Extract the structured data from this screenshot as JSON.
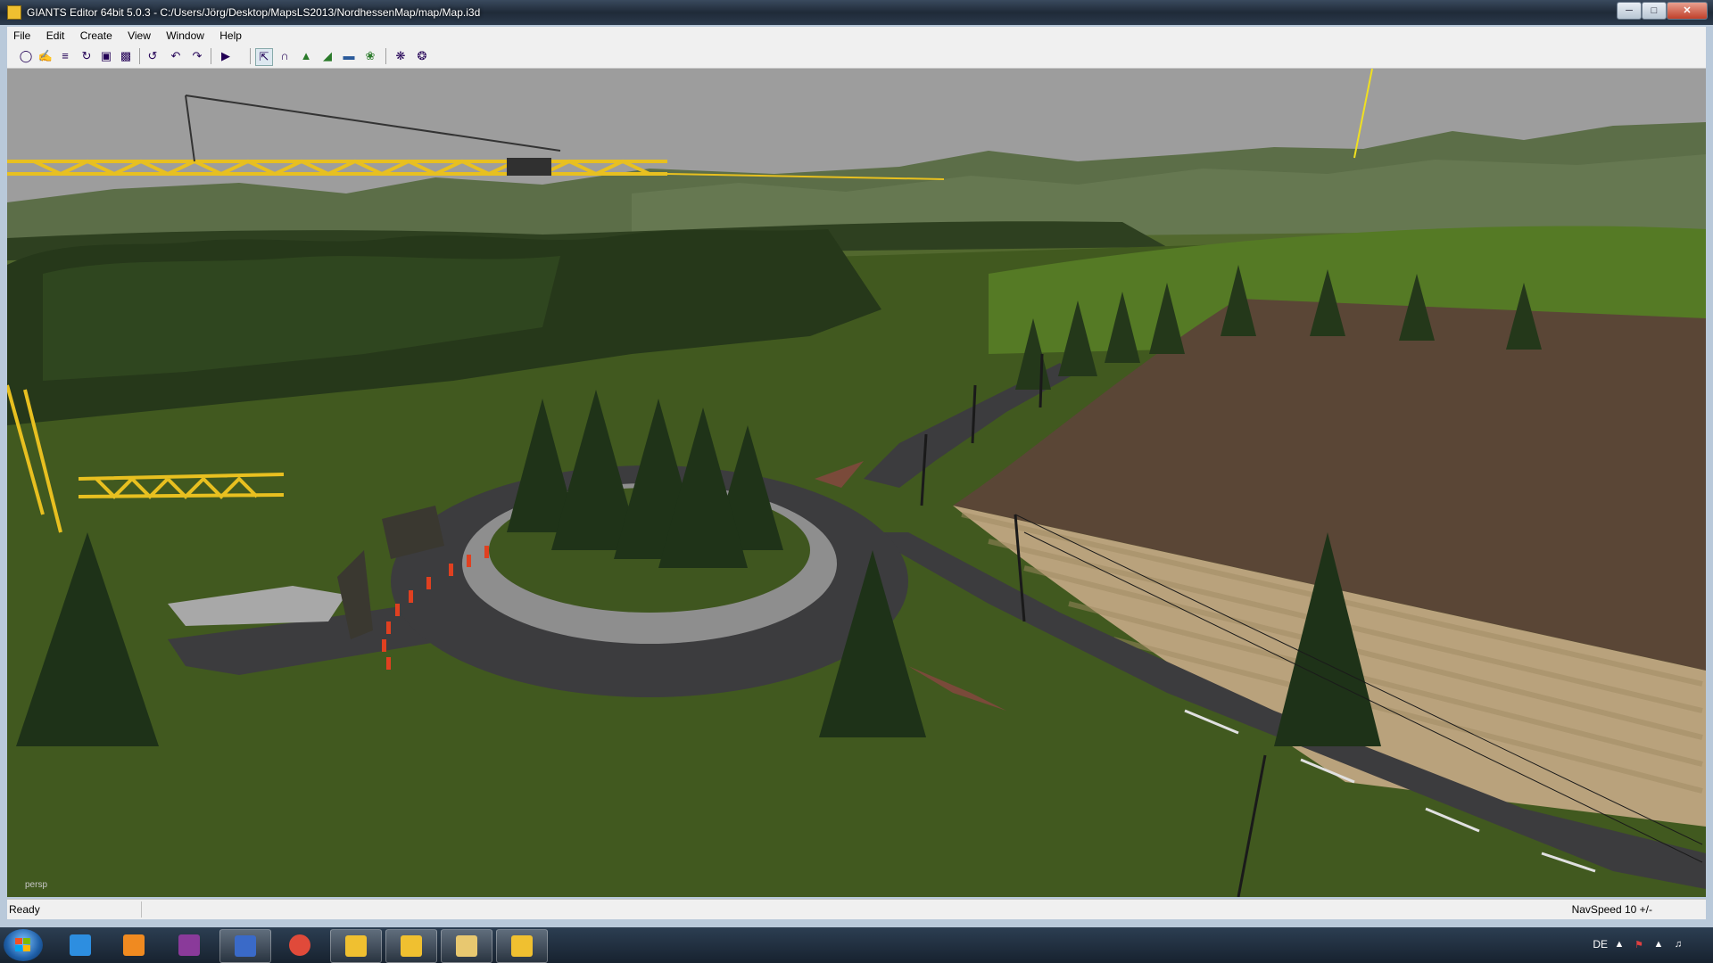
{
  "window": {
    "title": "GIANTS Editor 64bit 5.0.3 - C:/Users/Jörg/Desktop/MapsLS2013/NordhessenMap/map/Map.i3d",
    "minimize_icon": "minimize-icon",
    "maximize_icon": "maximize-icon",
    "close_icon": "close-icon"
  },
  "menu": {
    "items": [
      {
        "label": "File"
      },
      {
        "label": "Edit"
      },
      {
        "label": "Create"
      },
      {
        "label": "View"
      },
      {
        "label": "Window"
      },
      {
        "label": "Help"
      }
    ]
  },
  "toolbar": {
    "icons": [
      "new-icon",
      "open-icon",
      "list-icon",
      "reload-icon",
      "save-icon",
      "save-all-icon",
      "history-icon",
      "undo-icon",
      "redo-icon",
      "play-icon",
      "select-icon",
      "move-icon",
      "terrain-sculpt-icon",
      "terrain-paint-icon",
      "foliage-paint-icon",
      "grass-paint-icon",
      "scene-icon",
      "material-icon"
    ]
  },
  "viewport": {
    "camera_label": "persp"
  },
  "statusbar": {
    "status": "Ready",
    "navspeed": "NavSpeed 10 +/-"
  },
  "taskbar": {
    "items": [
      {
        "name": "internet-explorer-icon",
        "color": "#2d8ee0"
      },
      {
        "name": "media-player-icon",
        "color": "#f08a20"
      },
      {
        "name": "archive-icon",
        "color": "#8a3a9a"
      },
      {
        "name": "image-editor-icon",
        "color": "#3a6ac8"
      },
      {
        "name": "chrome-icon",
        "color": "#e04a3a"
      },
      {
        "name": "giants-editor-icon-1",
        "color": "#f0c030"
      },
      {
        "name": "giants-editor-icon-2",
        "color": "#f0c030"
      },
      {
        "name": "explorer-icon",
        "color": "#e8c870"
      },
      {
        "name": "giants-editor-icon-3",
        "color": "#f0c030"
      }
    ],
    "language": "DE"
  },
  "colors": {
    "sky": "#9d9d9d",
    "grass": "#3f5a22",
    "field_plowed": "#5a4636",
    "field_wheat": "#b9a27c",
    "road": "#3c3c3e",
    "crane": "#e8c020"
  }
}
